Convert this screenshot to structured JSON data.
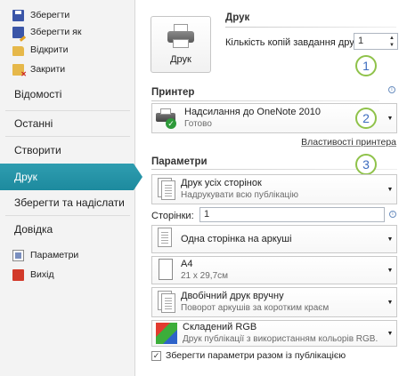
{
  "sidebar": {
    "top_items": [
      {
        "label": "Зберегти",
        "icon": "save-icon"
      },
      {
        "label": "Зберегти як",
        "icon": "save-as-icon"
      },
      {
        "label": "Відкрити",
        "icon": "open-folder-icon"
      },
      {
        "label": "Закрити",
        "icon": "close-folder-icon"
      }
    ],
    "main_items": [
      {
        "label": "Відомості"
      },
      {
        "label": "Останні"
      },
      {
        "label": "Створити"
      },
      {
        "label": "Друк",
        "active": true
      },
      {
        "label": "Зберегти та надіслати"
      },
      {
        "label": "Довідка"
      }
    ],
    "bottom_items": [
      {
        "label": "Параметри",
        "icon": "options-icon"
      },
      {
        "label": "Вихід",
        "icon": "exit-icon"
      }
    ],
    "active_color": "#2596a9"
  },
  "print": {
    "title": "Друк",
    "button_label": "Друк",
    "copies_label": "Кількість копій завдання друку:",
    "copies_value": "1",
    "spin_up": "▲",
    "spin_down": "▼"
  },
  "printer": {
    "title": "Принтер",
    "name": "Надсилання до OneNote 2010",
    "status": "Готово",
    "properties_link": "Властивості принтера"
  },
  "settings": {
    "title": "Параметри",
    "pages_label": "Сторінки:",
    "pages_value": "1",
    "dropdowns": [
      {
        "title": "Друк усіх сторінок",
        "subtitle": "Надрукувати всю публікацію"
      },
      {
        "title": "Одна сторінка на аркуші",
        "subtitle": ""
      },
      {
        "title": "A4",
        "subtitle": "21 x 29,7см"
      },
      {
        "title": "Двобічний друк вручну",
        "subtitle": "Поворот аркушів за коротким краєм"
      },
      {
        "title": "Складений RGB",
        "subtitle": "Друк публікації з використанням кольорів RGB."
      }
    ],
    "save_checkbox_label": "Зберегти параметри разом із публікацією",
    "save_checkbox_checked": true
  },
  "callouts": [
    "1",
    "2",
    "3"
  ],
  "dropdown_arrow": "▼",
  "check_mark": "✓",
  "info_glyph": "i",
  "colors": {
    "callout_border": "#8fc24a",
    "callout_text": "#3d6cbf"
  }
}
